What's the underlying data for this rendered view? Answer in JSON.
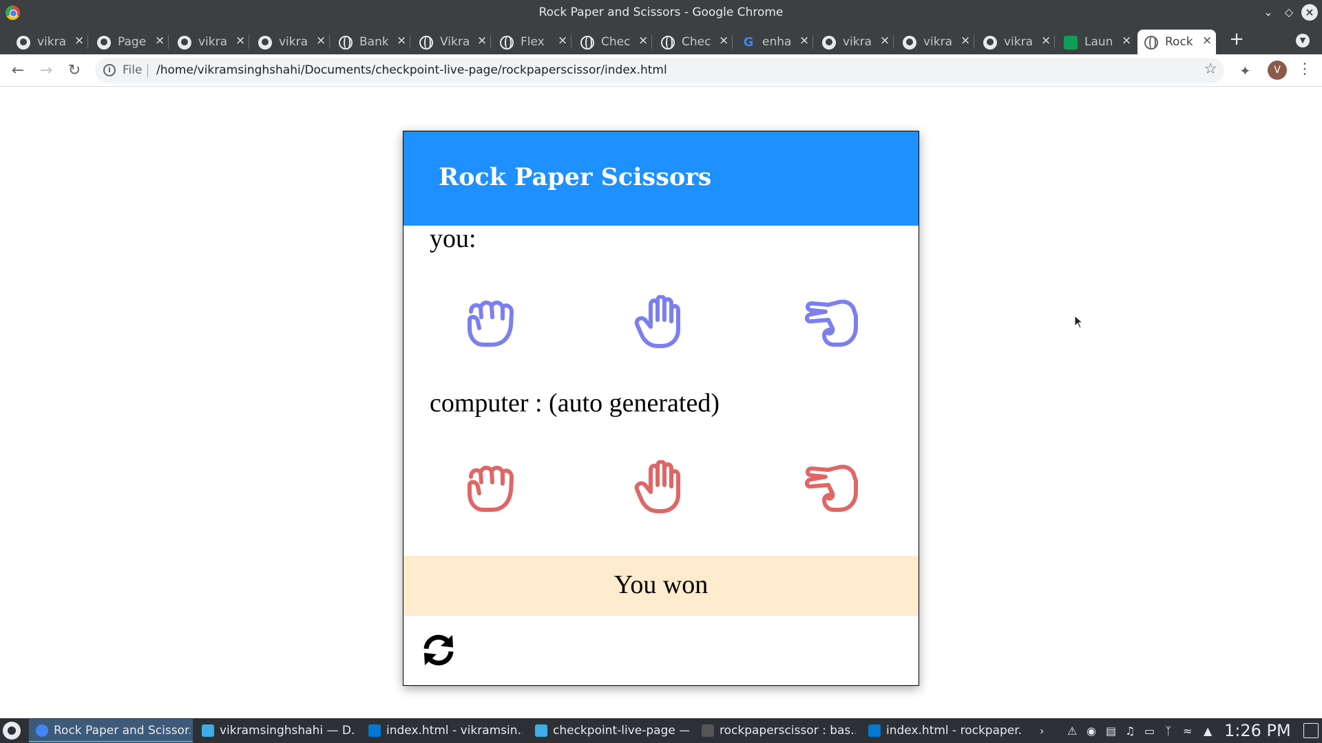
{
  "window": {
    "title": "Rock Paper and Scissors - Google Chrome"
  },
  "tabs": [
    {
      "label": "vikramsinghshahi",
      "icon": "github-icon"
    },
    {
      "label": "Pages",
      "icon": "github-icon"
    },
    {
      "label": "vikramsinghshahi",
      "icon": "github-icon"
    },
    {
      "label": "vikramsinghshahi",
      "icon": "github-icon"
    },
    {
      "label": "Bank",
      "icon": "globe-icon"
    },
    {
      "label": "Vikram",
      "icon": "globe-icon"
    },
    {
      "label": "Flex",
      "icon": "globe-icon"
    },
    {
      "label": "Checkpoint",
      "icon": "globe-icon"
    },
    {
      "label": "Checkpoint",
      "icon": "globe-icon"
    },
    {
      "label": "enhance",
      "icon": "google-icon"
    },
    {
      "label": "vikramsinghshahi",
      "icon": "github-icon"
    },
    {
      "label": "vikramsinghshahi",
      "icon": "github-icon"
    },
    {
      "label": "vikramsinghshahi",
      "icon": "github-icon"
    },
    {
      "label": "Launch",
      "icon": "sheets-icon"
    },
    {
      "label": "Rock",
      "icon": "globe-icon"
    }
  ],
  "toolbar": {
    "scheme": "File",
    "url": "/home/vikramsinghshahi/Documents/checkpoint-live-page/rockpaperscissor/index.html",
    "avatar_initial": "V"
  },
  "game": {
    "title": "Rock Paper Scissors",
    "you_label": "you:",
    "computer_label": "computer : (auto generated)",
    "player_color": "#7b7ff0",
    "computer_color": "#e06666",
    "header_color": "#1e90ff",
    "result_bg": "#ffebcd",
    "result": "You won",
    "choices": [
      "rock-icon",
      "paper-icon",
      "scissors-icon"
    ]
  },
  "taskbar": {
    "tasks": [
      {
        "label": "Rock Paper and Scissor...",
        "color": "#4285f4"
      },
      {
        "label": "vikramsinghshahi — D...",
        "color": "#3daee9"
      },
      {
        "label": "index.html - vikramsin...",
        "color": "#0078d4"
      },
      {
        "label": "checkpoint-live-page —...",
        "color": "#3daee9"
      },
      {
        "label": "rockpaperscissor : bas...",
        "color": "#555555"
      },
      {
        "label": "index.html - rockpaper...",
        "color": "#0078d4"
      }
    ],
    "time": "1:26 PM"
  }
}
